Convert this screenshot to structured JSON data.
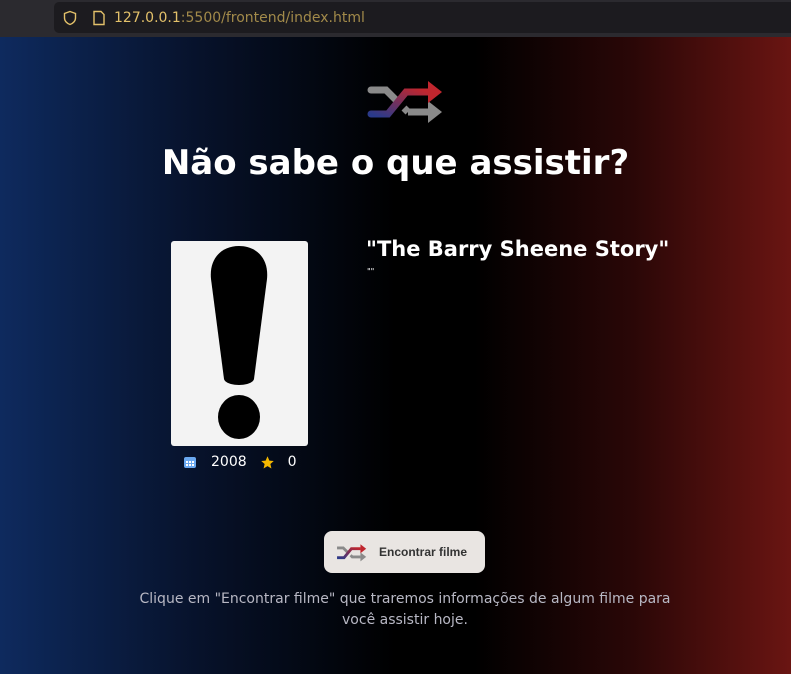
{
  "browser": {
    "url_host": "127.0.0.1",
    "url_rest": ":5500/frontend/index.html"
  },
  "header": {
    "title": "Não sabe o que assistir?"
  },
  "movie": {
    "title": "\"The Barry Sheene Story\"",
    "overview": "\"\"",
    "year": "2008",
    "rating": "0"
  },
  "button": {
    "label": "Encontrar filme"
  },
  "hint": "Clique em \"Encontrar filme\" que traremos informações de algum filme para você assistir hoje.",
  "colors": {
    "accent_red": "#b3262e",
    "accent_blue": "#2a3a8a",
    "star": "#f5b800",
    "calendar": "#6aa8f0"
  }
}
